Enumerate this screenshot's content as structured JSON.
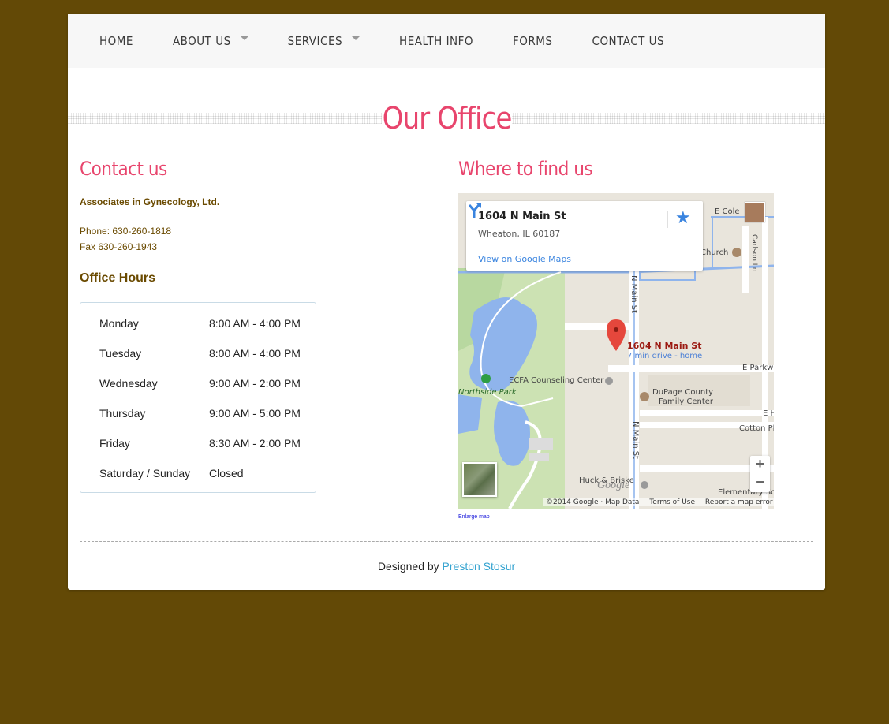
{
  "nav": {
    "items": [
      {
        "label": "HOME"
      },
      {
        "label": "ABOUT US"
      },
      {
        "label": "SERVICES"
      },
      {
        "label": "HEALTH INFO"
      },
      {
        "label": "FORMS"
      },
      {
        "label": "CONTACT US"
      }
    ]
  },
  "page_title": "Our Office",
  "contact": {
    "heading": "Contact us",
    "org_name": "Associates in Gynecology, Ltd.",
    "phone": "Phone: 630-260-1818",
    "fax": "Fax 630-260-1943",
    "hours_heading": "Office Hours",
    "hours": [
      {
        "day": "Monday",
        "time": "8:00 AM - 4:00 PM"
      },
      {
        "day": "Tuesday",
        "time": "8:00 AM - 4:00 PM"
      },
      {
        "day": "Wednesday",
        "time": "9:00 AM - 2:00 PM"
      },
      {
        "day": "Thursday",
        "time": "9:00 AM - 5:00 PM"
      },
      {
        "day": "Friday",
        "time": "8:30 AM - 2:00 PM"
      },
      {
        "day": "Saturday / Sunday",
        "time": "Closed"
      }
    ]
  },
  "map": {
    "heading": "Where to find us",
    "info_address": "1604 N Main St",
    "info_city": "Wheaton, IL 60187",
    "info_link": "View on Google Maps",
    "pin_label": "1604 N Main St",
    "pin_sublabel": "7 min drive - home",
    "labels": {
      "e_cole": "E Cole",
      "church": "Church",
      "carlson": "Carlson Ln",
      "n_main_1": "N Main St",
      "n_main_2": "N Main St",
      "ecfa": "ECFA Counseling Center",
      "northside": "Northside Park",
      "dupage1": "DuPage County",
      "dupage2": "Family Center",
      "e_park": "E Parkw",
      "e_h": "E H",
      "cotton": "Cotton Pl",
      "huck": "Huck & Briske",
      "elementary": "Elementary Sc"
    },
    "google": "Google",
    "footer": {
      "copyright": "©2014 Google · Map Data",
      "terms": "Terms of Use",
      "report": "Report a map error"
    },
    "zoom_in": "+",
    "zoom_out": "−",
    "enlarge": "Enlarge map"
  },
  "footer": {
    "designed_by": "Designed by ",
    "author": "Preston Stosur"
  },
  "colors": {
    "background": "#634906",
    "accent": "#e8456d",
    "text_brown": "#6a4a00",
    "link": "#34a3d0"
  }
}
